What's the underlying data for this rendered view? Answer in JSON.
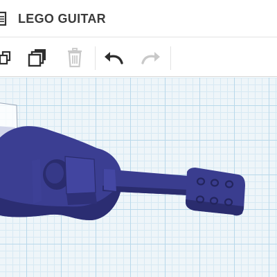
{
  "app": {
    "title": "LEGO GUITAR"
  },
  "toolbar": {
    "buttons": [
      {
        "name": "copy",
        "icon": "copy-icon",
        "enabled": true
      },
      {
        "name": "duplicate",
        "icon": "duplicate-icon",
        "enabled": true
      },
      {
        "name": "delete",
        "icon": "trash-icon",
        "enabled": false
      },
      {
        "name": "undo",
        "icon": "undo-arrow-icon",
        "enabled": true
      },
      {
        "name": "redo",
        "icon": "redo-arrow-icon",
        "enabled": false
      }
    ]
  },
  "workplane": {
    "grid": true,
    "object": {
      "name": "lego-guitar-model",
      "color": "#3a3d8f",
      "tuning_pegs": 6
    }
  },
  "colors": {
    "model": "#3a3d8f",
    "model_dark": "#2a2c6e",
    "grid_major": "#b8d8ea",
    "grid_minor": "#d7e9f3",
    "icon_active": "#2e2e2e",
    "icon_disabled": "#c9c9c9"
  }
}
